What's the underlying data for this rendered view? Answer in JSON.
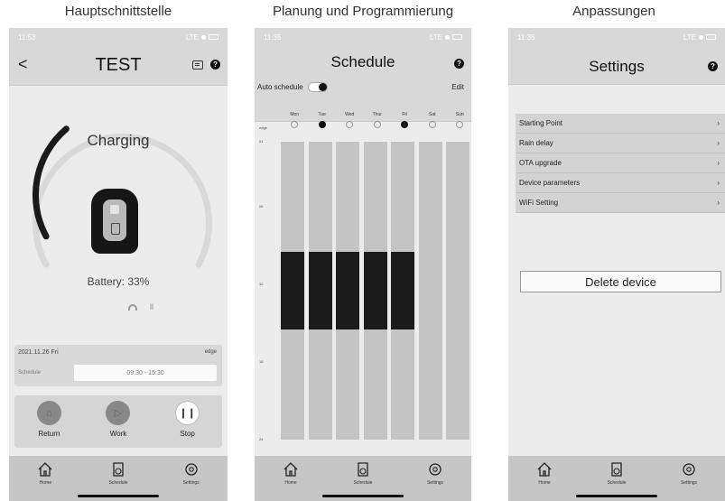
{
  "captions": [
    "Hauptschnittstelle",
    "Planung und Programmierung",
    "Anpassungen"
  ],
  "status": {
    "time": "11:53",
    "time2": "11:35",
    "signal": "LTE"
  },
  "main": {
    "title": "TEST",
    "state": "Charging",
    "battery": "Battery: 33%",
    "battery_percent": 33,
    "signal_text": "ll",
    "info": {
      "date": "2021.11.26 Fri",
      "tag": "edge",
      "label": "Schedule",
      "time": "09:30 - 15:30"
    },
    "controls": [
      {
        "label": "Return",
        "glyph": "⌂"
      },
      {
        "label": "Work",
        "glyph": "▷"
      },
      {
        "label": "Stop",
        "glyph": "❙❙"
      }
    ]
  },
  "tabs": [
    "Home",
    "Schedule",
    "Settings"
  ],
  "schedule": {
    "title": "Schedule",
    "auto_label": "Auto schedule",
    "edit_label": "Edit",
    "edge_label": "edge",
    "days": [
      "Mon",
      "Tue",
      "Wed",
      "Thur",
      "Fri",
      "Sat",
      "Sun"
    ],
    "day_edge_on": [
      false,
      true,
      false,
      false,
      true,
      false,
      false
    ],
    "hours": [
      "01",
      "06",
      "12",
      "18",
      "24"
    ],
    "slots": [
      {
        "day": "Mon",
        "start": 9.5,
        "end": 15.5
      },
      {
        "day": "Tue",
        "start": 9.5,
        "end": 15.5
      },
      {
        "day": "Wed",
        "start": 9.5,
        "end": 15.5
      },
      {
        "day": "Thur",
        "start": 9.5,
        "end": 15.5
      },
      {
        "day": "Fri",
        "start": 9.5,
        "end": 15.5
      }
    ]
  },
  "settings": {
    "title": "Settings",
    "items": [
      "Starting Point",
      "Rain delay",
      "OTA upgrade",
      "Device parameters",
      "WiFi Setting"
    ],
    "delete_label": "Delete device"
  }
}
